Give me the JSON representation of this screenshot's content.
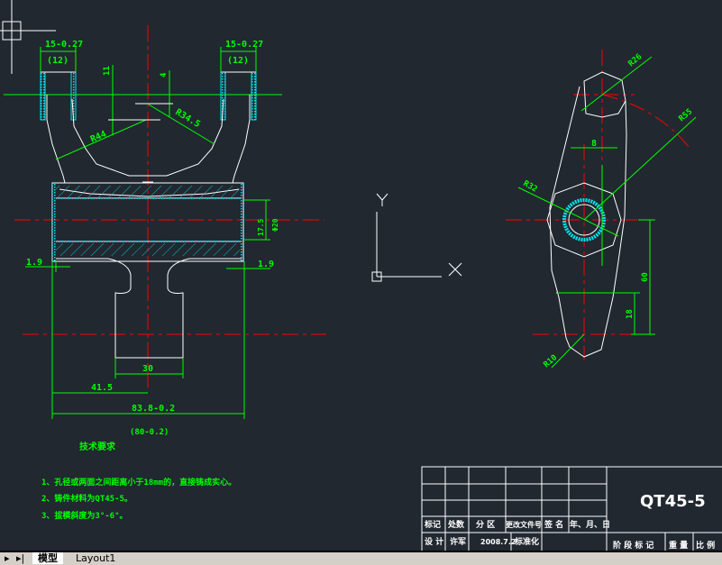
{
  "drawing": {
    "dims_front": {
      "prong_width": "15-0.27",
      "prong_ref": "(12)",
      "h11": "11",
      "h4": "4",
      "r44": "R44",
      "r34": "R34.5",
      "gap_left": "1.9",
      "gap_right": "1.9",
      "bore": "17.5",
      "bore_dia": "Φ20",
      "stem_width": "30",
      "half_width": "41.5",
      "overall": "83.8-0.2",
      "overall_ref": "(80-0.2)"
    },
    "dims_side": {
      "r_top": "R26",
      "r_arc": "R55",
      "r_hub": "R32",
      "offset": "8",
      "len60": "60",
      "len18": "18",
      "r_bottom": "R10"
    },
    "notes": {
      "title": "技术要求",
      "items": [
        "1、孔径或两面之间距离小于18mm的，直接铸成实心。",
        "2、铸件材料为QT45-5。",
        "3、拔模斜度为3°-6°。"
      ]
    },
    "ucs": {
      "x_label": "X",
      "y_label": "Y"
    }
  },
  "title_block": {
    "part_name": "QT45-5",
    "headers": [
      "标记",
      "处数",
      "分 区",
      "更改文件号",
      "签 名",
      "年、月、日"
    ],
    "design_row": [
      "设 计",
      "许军",
      "2008.7.2",
      "标准化"
    ],
    "right_labels": [
      "阶 段 标 记",
      "重 量",
      "比 例"
    ]
  },
  "tabs": {
    "model": "模型",
    "layout1": "Layout1"
  },
  "colors": {
    "background": "#212830",
    "object": "#ffffff",
    "dimension": "#00ff00",
    "center": "#ff0000",
    "hatch": "#00e5ee"
  }
}
